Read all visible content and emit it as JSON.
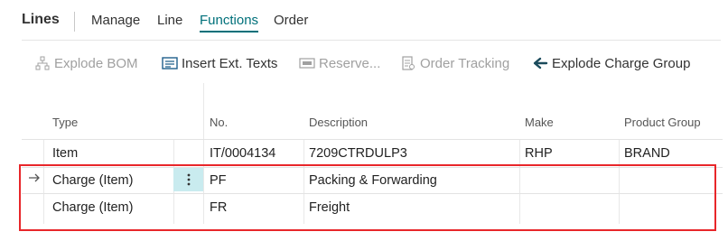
{
  "header": {
    "title": "Lines",
    "tabs": [
      "Manage",
      "Line",
      "Functions",
      "Order"
    ],
    "active_tab": "Functions"
  },
  "actions": [
    {
      "label": "Explode BOM",
      "icon": "explode-bom-icon",
      "enabled": false
    },
    {
      "label": "Insert Ext. Texts",
      "icon": "insert-text-icon",
      "enabled": true
    },
    {
      "label": "Reserve...",
      "icon": "reserve-icon",
      "enabled": false
    },
    {
      "label": "Order Tracking",
      "icon": "order-tracking-icon",
      "enabled": false
    },
    {
      "label": "Explode Charge Group",
      "icon": "arrow-left-icon",
      "enabled": true
    }
  ],
  "table": {
    "columns": [
      "Type",
      "No.",
      "Description",
      "Make",
      "Product Group"
    ],
    "rows": [
      {
        "type": "Item",
        "no": "IT/0004134",
        "description": "7209CTRDULP3",
        "make": "RHP",
        "product_group": "BRAND"
      },
      {
        "type": "Charge (Item)",
        "no": "PF",
        "description": "Packing & Forwarding",
        "make": "",
        "product_group": ""
      },
      {
        "type": "Charge (Item)",
        "no": "FR",
        "description": "Freight",
        "make": "",
        "product_group": ""
      }
    ]
  },
  "colors": {
    "accent": "#00707a",
    "highlight": "#e8262a",
    "selected_cell": "#c9ebef"
  }
}
